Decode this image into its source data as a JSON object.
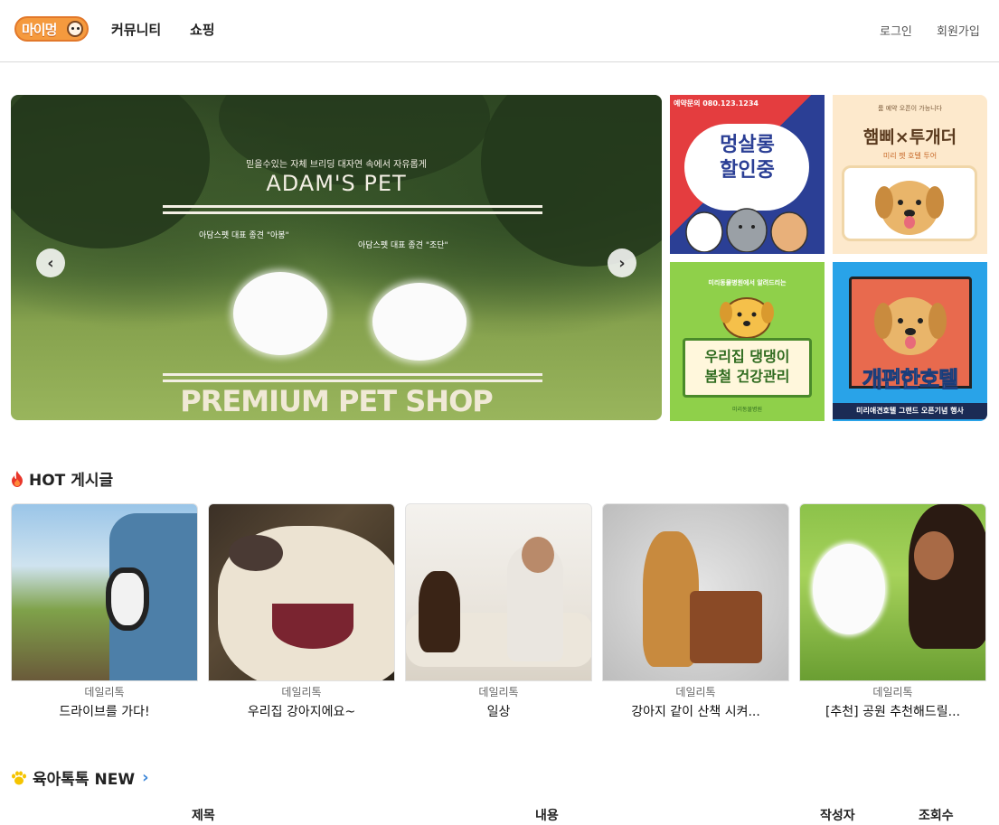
{
  "header": {
    "logo_text": "마이멍",
    "nav": [
      {
        "label": "커뮤니티"
      },
      {
        "label": "쇼핑"
      }
    ],
    "auth": {
      "login": "로그인",
      "signup": "회원가입"
    }
  },
  "banner": {
    "subtitle": "믿을수있는 자체 브리딩 대자연 속에서 자유롭게",
    "title": "ADAM'S PET",
    "note_1": "아담스펫 대표 종견 \"아봉\"",
    "note_2": "아담스펫 대표 종견 \"조단\"",
    "bottom_title": "PREMIUM PET SHOP",
    "prev_icon": "chevron-left-icon",
    "next_icon": "chevron-right-icon"
  },
  "ads": [
    {
      "badge": "예약문의 080.123.1234",
      "title_line1": "멍살롱",
      "title_line2": "할인중",
      "colors": [
        "#e43d3f",
        "#2b3f95"
      ]
    },
    {
      "small": "룸 예약 오픈이 가능니다",
      "title": "햄삐×투개더",
      "sub": "미리 펫 호텔 투어",
      "colors": [
        "#fde9cc"
      ]
    },
    {
      "small": "미리동물병원에서 알려드리는",
      "title_line1": "우리집 댕댕이",
      "title_line2": "봄철 건강관리",
      "foot": "미리동물병원",
      "colors": [
        "#8fd04a"
      ]
    },
    {
      "title": "개편한호텔",
      "foot": "미리애견호텔 그랜드 오픈기념 행사",
      "colors": [
        "#29a3e8"
      ]
    }
  ],
  "hot_section": {
    "title": "HOT 게시글",
    "icon": "fire-icon",
    "cards": [
      {
        "category": "데일리톡",
        "title": "드라이브를 가다!"
      },
      {
        "category": "데일리톡",
        "title": "우리집 강아지에요~"
      },
      {
        "category": "데일리톡",
        "title": "일상"
      },
      {
        "category": "데일리톡",
        "title": "강아지 같이 산책 시켜..."
      },
      {
        "category": "데일리톡",
        "title": "[추천] 공원 추천해드릴..."
      }
    ]
  },
  "talk_section": {
    "title": "육아톡톡 NEW",
    "icon": "paw-icon",
    "more_icon": "chevron-right-icon",
    "columns": [
      "제목",
      "내용",
      "작성자",
      "조회수"
    ]
  }
}
